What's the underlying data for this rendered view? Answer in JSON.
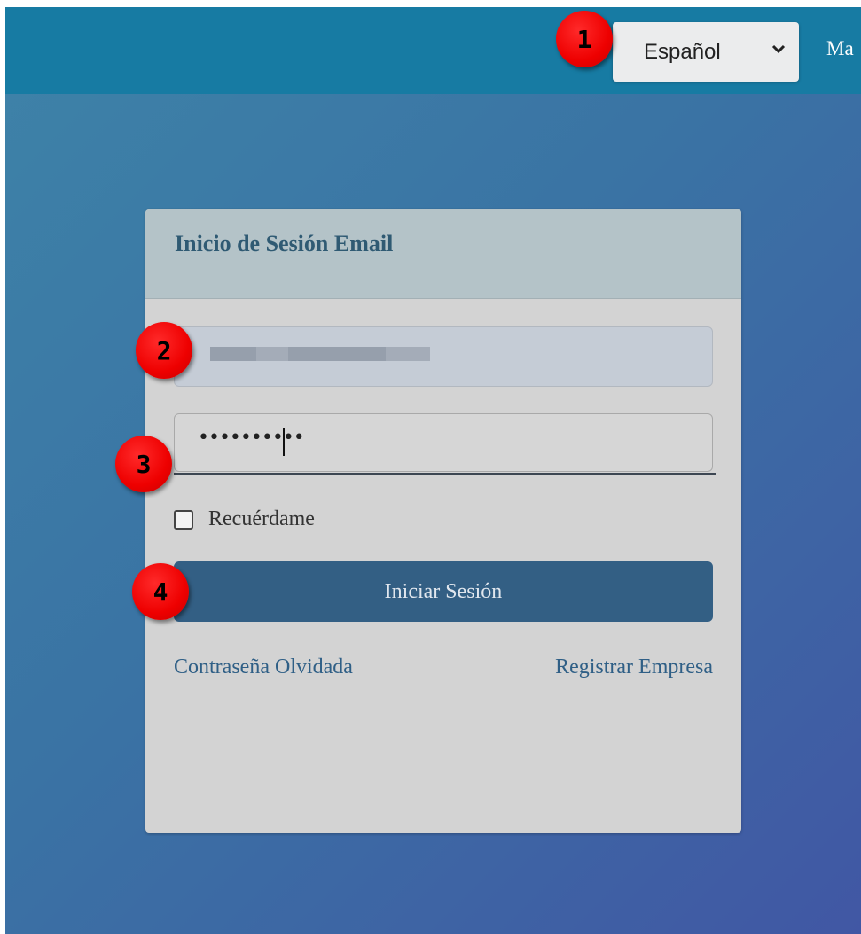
{
  "header": {
    "language_select": {
      "value": "Español"
    },
    "menu_partial_text": "Ma"
  },
  "login_card": {
    "title": "Inicio de Sesión Email",
    "email_field": {
      "value": ""
    },
    "password_field": {
      "masked_value": "••••••••••"
    },
    "remember_label": "Recuérdame",
    "login_button_label": "Iniciar Sesión",
    "forgot_password_link": "Contraseña Olvidada",
    "register_company_link": "Registrar Empresa"
  },
  "annotations": [
    {
      "number": "1"
    },
    {
      "number": "2"
    },
    {
      "number": "3"
    },
    {
      "number": "4"
    }
  ],
  "colors": {
    "topbar": "#177ba3",
    "button": "#335f84",
    "badge": "#ee0000",
    "link": "#2f5f86"
  }
}
